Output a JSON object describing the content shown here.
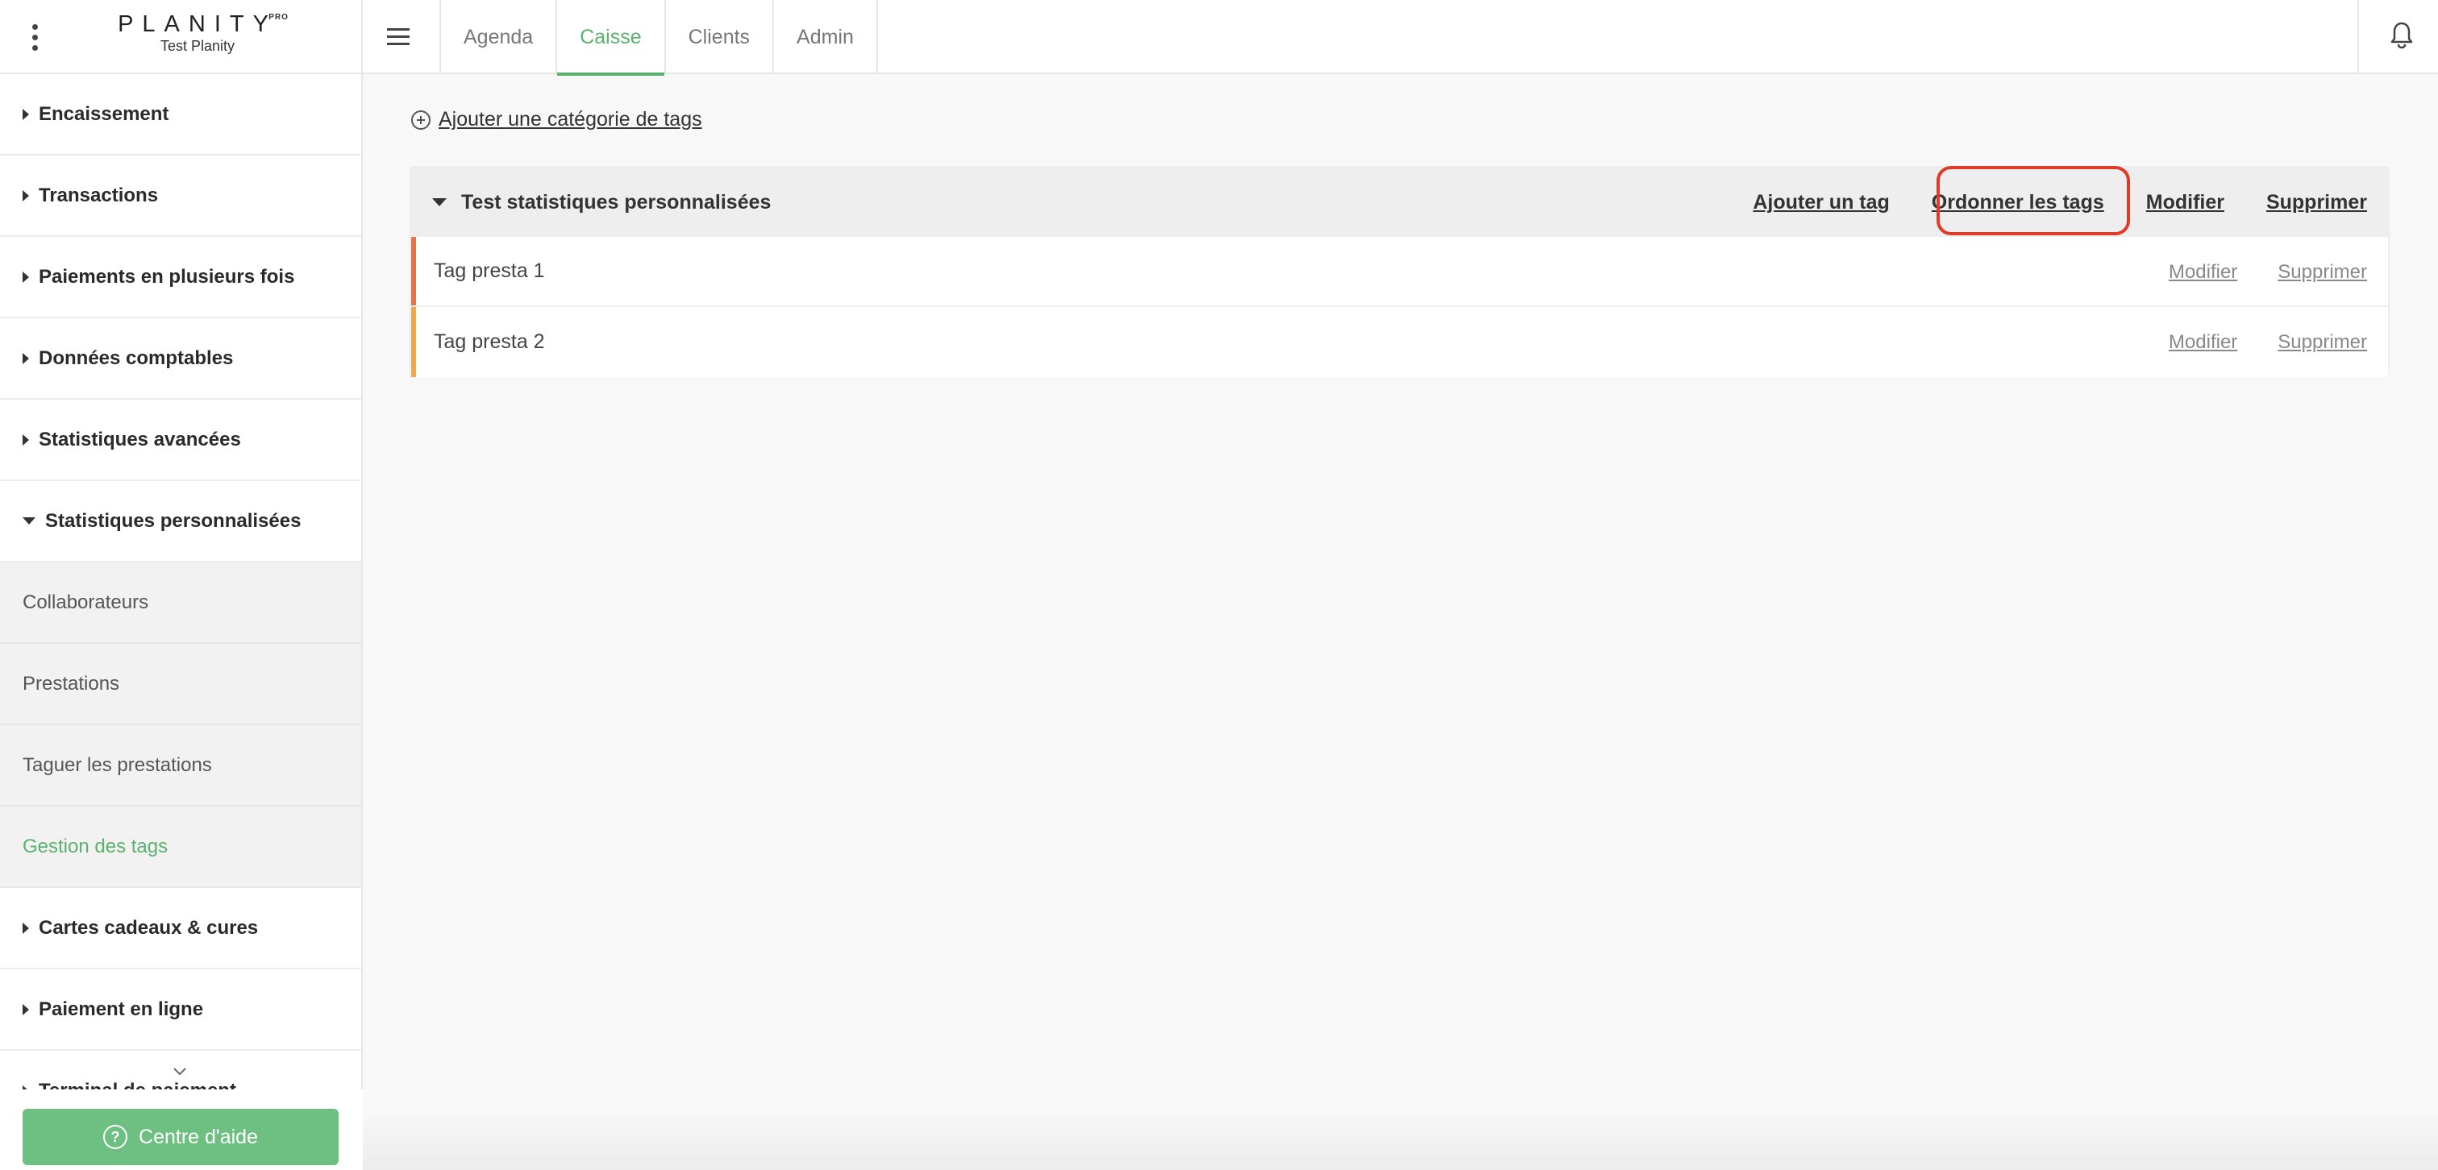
{
  "header": {
    "logo_text": "PLANITY",
    "logo_badge": "PRO",
    "account_name": "Test Planity",
    "tabs": [
      {
        "label": "Agenda",
        "active": false
      },
      {
        "label": "Caisse",
        "active": true
      },
      {
        "label": "Clients",
        "active": false
      },
      {
        "label": "Admin",
        "active": false
      }
    ]
  },
  "sidebar": {
    "items": [
      {
        "label": "Encaissement",
        "expanded": false
      },
      {
        "label": "Transactions",
        "expanded": false
      },
      {
        "label": "Paiements en plusieurs fois",
        "expanded": false
      },
      {
        "label": "Données comptables",
        "expanded": false
      },
      {
        "label": "Statistiques avancées",
        "expanded": false
      },
      {
        "label": "Statistiques personnalisées",
        "expanded": true
      }
    ],
    "subitems": [
      {
        "label": "Collaborateurs",
        "active": false
      },
      {
        "label": "Prestations",
        "active": false
      },
      {
        "label": "Taguer les prestations",
        "active": false
      },
      {
        "label": "Gestion des tags",
        "active": true
      }
    ],
    "items_after": [
      {
        "label": "Cartes cadeaux & cures"
      },
      {
        "label": "Paiement en ligne"
      },
      {
        "label": "Terminal de paiement"
      }
    ],
    "help_button": "Centre d'aide"
  },
  "main": {
    "add_category_label": "Ajouter une catégorie de tags",
    "category": {
      "title": "Test statistiques personnalisées",
      "actions": {
        "add_tag": "Ajouter un tag",
        "order_tags": "Ordonner les tags",
        "edit": "Modifier",
        "delete": "Supprimer"
      },
      "tags": [
        {
          "name": "Tag presta 1",
          "color": "#e8734a",
          "edit": "Modifier",
          "delete": "Supprimer"
        },
        {
          "name": "Tag presta 2",
          "color": "#f0a850",
          "edit": "Modifier",
          "delete": "Supprimer"
        }
      ]
    }
  },
  "colors": {
    "accent": "#59b26d",
    "help_button": "#6dbf82",
    "highlight": "#e03a2a"
  }
}
